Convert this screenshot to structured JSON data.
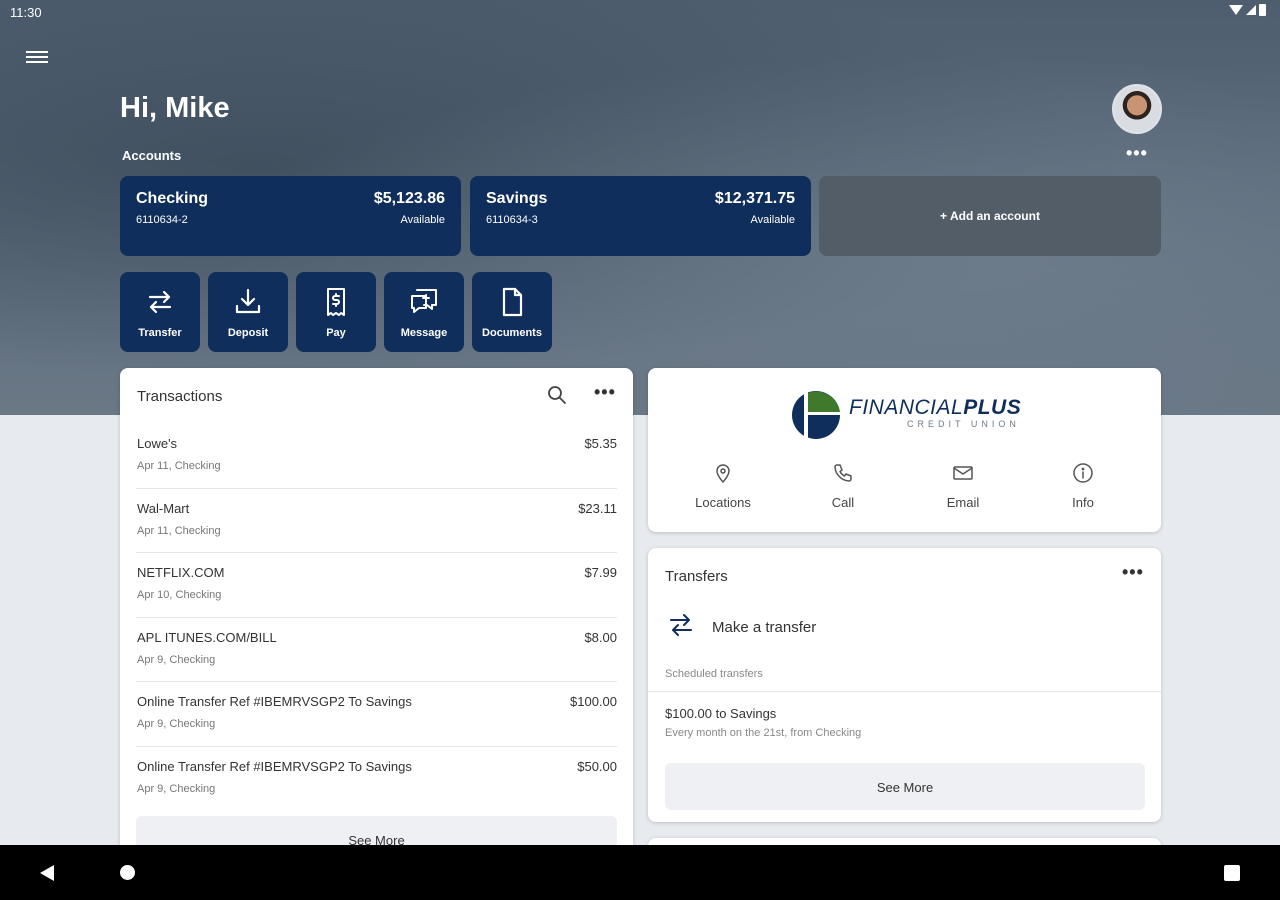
{
  "status_bar": {
    "time": "11:30"
  },
  "header": {
    "greeting": "Hi, Mike",
    "accounts_label": "Accounts",
    "more_label": "•••"
  },
  "accounts": [
    {
      "name": "Checking",
      "number": "6110634-2",
      "balance": "$5,123.86",
      "balance_label": "Available"
    },
    {
      "name": "Savings",
      "number": "6110634-3",
      "balance": "$12,371.75",
      "balance_label": "Available"
    }
  ],
  "add_account_label": "+ Add an account",
  "quick_actions": [
    {
      "label": "Transfer",
      "icon": "transfer-icon"
    },
    {
      "label": "Deposit",
      "icon": "deposit-icon"
    },
    {
      "label": "Pay",
      "icon": "pay-bill-icon"
    },
    {
      "label": "Message",
      "icon": "message-icon"
    },
    {
      "label": "Documents",
      "icon": "document-icon"
    }
  ],
  "transactions": {
    "title": "Transactions",
    "more_label": "•••",
    "items": [
      {
        "merchant": "Lowe's",
        "meta": "Apr 11, Checking",
        "amount": "$5.35"
      },
      {
        "merchant": "Wal-Mart",
        "meta": "Apr 11, Checking",
        "amount": "$23.11"
      },
      {
        "merchant": "NETFLIX.COM",
        "meta": "Apr 10, Checking",
        "amount": "$7.99"
      },
      {
        "merchant": "APL ITUNES.COM/BILL",
        "meta": "Apr 9, Checking",
        "amount": "$8.00"
      },
      {
        "merchant": "Online Transfer Ref #IBEMRVSGP2 To Savings",
        "meta": "Apr 9, Checking",
        "amount": "$100.00"
      },
      {
        "merchant": "Online Transfer Ref #IBEMRVSGP2 To Savings",
        "meta": "Apr 9, Checking",
        "amount": "$50.00"
      }
    ],
    "see_more": "See More"
  },
  "credit_union": {
    "logo_name_light": "FINANCIAL",
    "logo_name_bold": "PLUS",
    "logo_subtitle": "CREDIT UNION",
    "actions": [
      {
        "label": "Locations",
        "icon": "location-pin-icon"
      },
      {
        "label": "Call",
        "icon": "phone-icon"
      },
      {
        "label": "Email",
        "icon": "email-icon"
      },
      {
        "label": "Info",
        "icon": "info-icon"
      }
    ]
  },
  "transfers": {
    "title": "Transfers",
    "more_label": "•••",
    "make_transfer": "Make a transfer",
    "scheduled_label": "Scheduled transfers",
    "scheduled": [
      {
        "title": "$100.00 to Savings",
        "description": "Every month on the 21st, from Checking"
      }
    ],
    "see_more": "See More"
  },
  "colors": {
    "brand_navy": "#0f2e5c",
    "brand_green": "#3f7a2c",
    "page_bg": "#e7eaee"
  }
}
